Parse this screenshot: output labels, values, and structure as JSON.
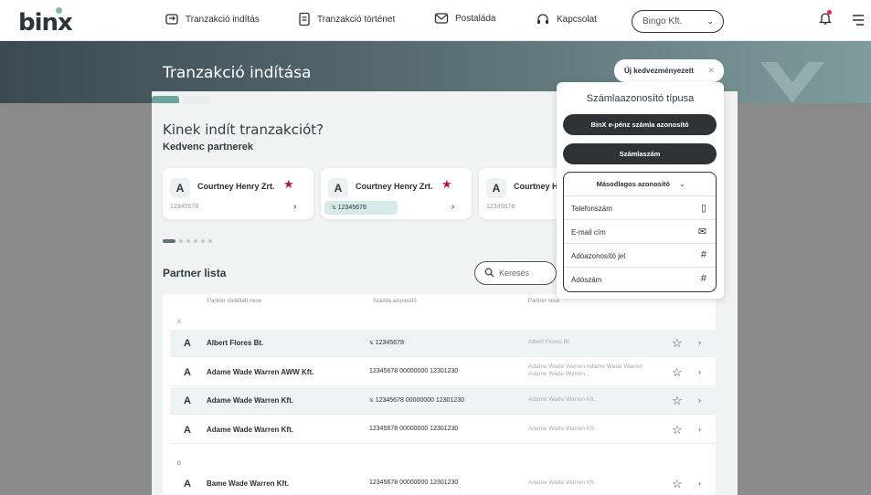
{
  "brand": {
    "logo": "binx",
    "accent": "#6aa6a0",
    "dark": "#2e3338"
  },
  "nav": {
    "items": [
      {
        "label": "Tranzakció indítás",
        "icon": "transaction-start-icon"
      },
      {
        "label": "Tranzakció történet",
        "icon": "history-document-icon"
      },
      {
        "label": "Postaláda",
        "icon": "mail-icon"
      },
      {
        "label": "Kapcsolat",
        "icon": "headset-icon"
      }
    ],
    "company": "Bingo Kft."
  },
  "page": {
    "title": "Tranzakció indítása",
    "question": "Kinek indít tranzakciót?",
    "favorites_title": "Kedvenc partnerek"
  },
  "favorites": [
    {
      "avatar": "A",
      "name": "Courtney Henry Zrt.",
      "account": "12345678"
    },
    {
      "avatar": "A",
      "name": "Courtney Henry Zrt.",
      "account": "12345678"
    },
    {
      "avatar": "A",
      "name": "Courtney He",
      "account": "12345678"
    }
  ],
  "partner_list": {
    "title": "Partner lista",
    "search_placeholder": "Keresés",
    "headers": {
      "name": "Partner rövidített neve",
      "account": "Számla azonosító",
      "partner": "Partner neve"
    },
    "groups": [
      "A",
      "B"
    ],
    "rows": [
      {
        "avatar": "A",
        "name": "Albert Flores Bt.",
        "account": "12345678",
        "partner": "Albert Flores Bt."
      },
      {
        "avatar": "A",
        "name": "Adame Wade Warren AWW Kft.",
        "account": "12345678 00000000 12301230",
        "partner": "Adame Wade Warren Adame Wade Warren Adame Wade Warren..."
      },
      {
        "avatar": "A",
        "name": "Adame Wade Warren Kft.",
        "account": "12345678 00000000 12301230",
        "partner": "Adame Wade Warren Kft."
      },
      {
        "avatar": "A",
        "name": "Adame Wade Warren Kft.",
        "account": "12345678 00000000 12301230",
        "partner": "Adame Wade Warren Kft."
      },
      {
        "avatar": "A",
        "name": "Bame Wade Warren Kft.",
        "account": "12345678 00000000 12301230",
        "partner": "Adame Wade Warren Kft."
      }
    ]
  },
  "popup": {
    "new_beneficiary": "Új kedvezményezett",
    "title": "Számlaazonosító típusa",
    "btn_epenz": "BinX e-pénz számla azonosító",
    "btn_account": "Számlaszám",
    "secondary": "Másodlagos azonosító",
    "items": [
      {
        "label": "Telefonszám",
        "icon": "phone-icon"
      },
      {
        "label": "E-mail cím",
        "icon": "mail-icon"
      },
      {
        "label": "Adóazonosító jel",
        "icon": "hash-icon"
      },
      {
        "label": "Adószám",
        "icon": "hash-icon"
      }
    ]
  }
}
